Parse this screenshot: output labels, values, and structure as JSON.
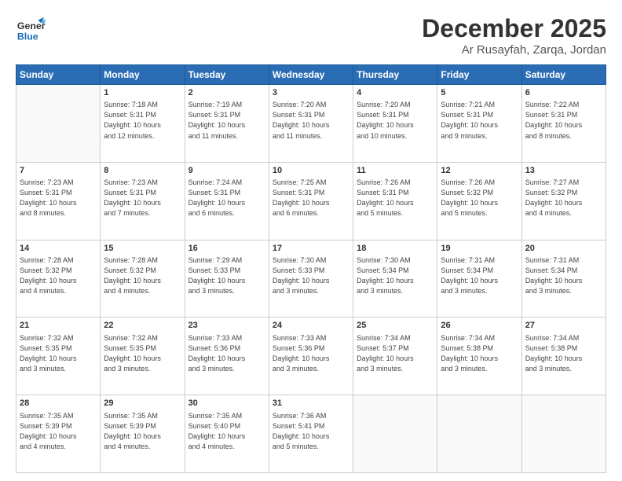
{
  "header": {
    "logo_general": "General",
    "logo_blue": "Blue",
    "month": "December 2025",
    "location": "Ar Rusayfah, Zarqa, Jordan"
  },
  "days_of_week": [
    "Sunday",
    "Monday",
    "Tuesday",
    "Wednesday",
    "Thursday",
    "Friday",
    "Saturday"
  ],
  "weeks": [
    [
      {
        "day": "",
        "sunrise": "",
        "sunset": "",
        "daylight": ""
      },
      {
        "day": "1",
        "sunrise": "Sunrise: 7:18 AM",
        "sunset": "Sunset: 5:31 PM",
        "daylight": "Daylight: 10 hours and 12 minutes."
      },
      {
        "day": "2",
        "sunrise": "Sunrise: 7:19 AM",
        "sunset": "Sunset: 5:31 PM",
        "daylight": "Daylight: 10 hours and 11 minutes."
      },
      {
        "day": "3",
        "sunrise": "Sunrise: 7:20 AM",
        "sunset": "Sunset: 5:31 PM",
        "daylight": "Daylight: 10 hours and 11 minutes."
      },
      {
        "day": "4",
        "sunrise": "Sunrise: 7:20 AM",
        "sunset": "Sunset: 5:31 PM",
        "daylight": "Daylight: 10 hours and 10 minutes."
      },
      {
        "day": "5",
        "sunrise": "Sunrise: 7:21 AM",
        "sunset": "Sunset: 5:31 PM",
        "daylight": "Daylight: 10 hours and 9 minutes."
      },
      {
        "day": "6",
        "sunrise": "Sunrise: 7:22 AM",
        "sunset": "Sunset: 5:31 PM",
        "daylight": "Daylight: 10 hours and 8 minutes."
      }
    ],
    [
      {
        "day": "7",
        "sunrise": "Sunrise: 7:23 AM",
        "sunset": "Sunset: 5:31 PM",
        "daylight": "Daylight: 10 hours and 8 minutes."
      },
      {
        "day": "8",
        "sunrise": "Sunrise: 7:23 AM",
        "sunset": "Sunset: 5:31 PM",
        "daylight": "Daylight: 10 hours and 7 minutes."
      },
      {
        "day": "9",
        "sunrise": "Sunrise: 7:24 AM",
        "sunset": "Sunset: 5:31 PM",
        "daylight": "Daylight: 10 hours and 6 minutes."
      },
      {
        "day": "10",
        "sunrise": "Sunrise: 7:25 AM",
        "sunset": "Sunset: 5:31 PM",
        "daylight": "Daylight: 10 hours and 6 minutes."
      },
      {
        "day": "11",
        "sunrise": "Sunrise: 7:26 AM",
        "sunset": "Sunset: 5:31 PM",
        "daylight": "Daylight: 10 hours and 5 minutes."
      },
      {
        "day": "12",
        "sunrise": "Sunrise: 7:26 AM",
        "sunset": "Sunset: 5:32 PM",
        "daylight": "Daylight: 10 hours and 5 minutes."
      },
      {
        "day": "13",
        "sunrise": "Sunrise: 7:27 AM",
        "sunset": "Sunset: 5:32 PM",
        "daylight": "Daylight: 10 hours and 4 minutes."
      }
    ],
    [
      {
        "day": "14",
        "sunrise": "Sunrise: 7:28 AM",
        "sunset": "Sunset: 5:32 PM",
        "daylight": "Daylight: 10 hours and 4 minutes."
      },
      {
        "day": "15",
        "sunrise": "Sunrise: 7:28 AM",
        "sunset": "Sunset: 5:32 PM",
        "daylight": "Daylight: 10 hours and 4 minutes."
      },
      {
        "day": "16",
        "sunrise": "Sunrise: 7:29 AM",
        "sunset": "Sunset: 5:33 PM",
        "daylight": "Daylight: 10 hours and 3 minutes."
      },
      {
        "day": "17",
        "sunrise": "Sunrise: 7:30 AM",
        "sunset": "Sunset: 5:33 PM",
        "daylight": "Daylight: 10 hours and 3 minutes."
      },
      {
        "day": "18",
        "sunrise": "Sunrise: 7:30 AM",
        "sunset": "Sunset: 5:34 PM",
        "daylight": "Daylight: 10 hours and 3 minutes."
      },
      {
        "day": "19",
        "sunrise": "Sunrise: 7:31 AM",
        "sunset": "Sunset: 5:34 PM",
        "daylight": "Daylight: 10 hours and 3 minutes."
      },
      {
        "day": "20",
        "sunrise": "Sunrise: 7:31 AM",
        "sunset": "Sunset: 5:34 PM",
        "daylight": "Daylight: 10 hours and 3 minutes."
      }
    ],
    [
      {
        "day": "21",
        "sunrise": "Sunrise: 7:32 AM",
        "sunset": "Sunset: 5:35 PM",
        "daylight": "Daylight: 10 hours and 3 minutes."
      },
      {
        "day": "22",
        "sunrise": "Sunrise: 7:32 AM",
        "sunset": "Sunset: 5:35 PM",
        "daylight": "Daylight: 10 hours and 3 minutes."
      },
      {
        "day": "23",
        "sunrise": "Sunrise: 7:33 AM",
        "sunset": "Sunset: 5:36 PM",
        "daylight": "Daylight: 10 hours and 3 minutes."
      },
      {
        "day": "24",
        "sunrise": "Sunrise: 7:33 AM",
        "sunset": "Sunset: 5:36 PM",
        "daylight": "Daylight: 10 hours and 3 minutes."
      },
      {
        "day": "25",
        "sunrise": "Sunrise: 7:34 AM",
        "sunset": "Sunset: 5:37 PM",
        "daylight": "Daylight: 10 hours and 3 minutes."
      },
      {
        "day": "26",
        "sunrise": "Sunrise: 7:34 AM",
        "sunset": "Sunset: 5:38 PM",
        "daylight": "Daylight: 10 hours and 3 minutes."
      },
      {
        "day": "27",
        "sunrise": "Sunrise: 7:34 AM",
        "sunset": "Sunset: 5:38 PM",
        "daylight": "Daylight: 10 hours and 3 minutes."
      }
    ],
    [
      {
        "day": "28",
        "sunrise": "Sunrise: 7:35 AM",
        "sunset": "Sunset: 5:39 PM",
        "daylight": "Daylight: 10 hours and 4 minutes."
      },
      {
        "day": "29",
        "sunrise": "Sunrise: 7:35 AM",
        "sunset": "Sunset: 5:39 PM",
        "daylight": "Daylight: 10 hours and 4 minutes."
      },
      {
        "day": "30",
        "sunrise": "Sunrise: 7:35 AM",
        "sunset": "Sunset: 5:40 PM",
        "daylight": "Daylight: 10 hours and 4 minutes."
      },
      {
        "day": "31",
        "sunrise": "Sunrise: 7:36 AM",
        "sunset": "Sunset: 5:41 PM",
        "daylight": "Daylight: 10 hours and 5 minutes."
      },
      {
        "day": "",
        "sunrise": "",
        "sunset": "",
        "daylight": ""
      },
      {
        "day": "",
        "sunrise": "",
        "sunset": "",
        "daylight": ""
      },
      {
        "day": "",
        "sunrise": "",
        "sunset": "",
        "daylight": ""
      }
    ]
  ]
}
